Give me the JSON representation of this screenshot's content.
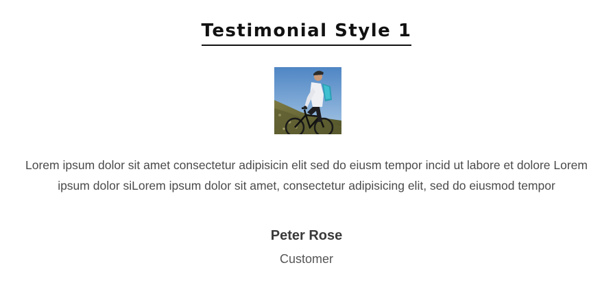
{
  "testimonial": {
    "title": "Testimonial Style 1",
    "quote": "Lorem ipsum dolor sit amet consectetur adipisicin elit sed do eiusm tempor incid ut labore et dolore Lorem ipsum dolor siLorem ipsum dolor sit amet, consectetur adipisicing elit, sed do eiusmod tempor",
    "author_name": "Peter Rose",
    "author_role": "Customer",
    "avatar_icon": "cyclist-photo"
  },
  "colors": {
    "title": "#111111",
    "text": "#4a4a4a",
    "name": "#3a3a3a",
    "sky": "#6f9fd0",
    "hill": "#6b6f3a"
  }
}
